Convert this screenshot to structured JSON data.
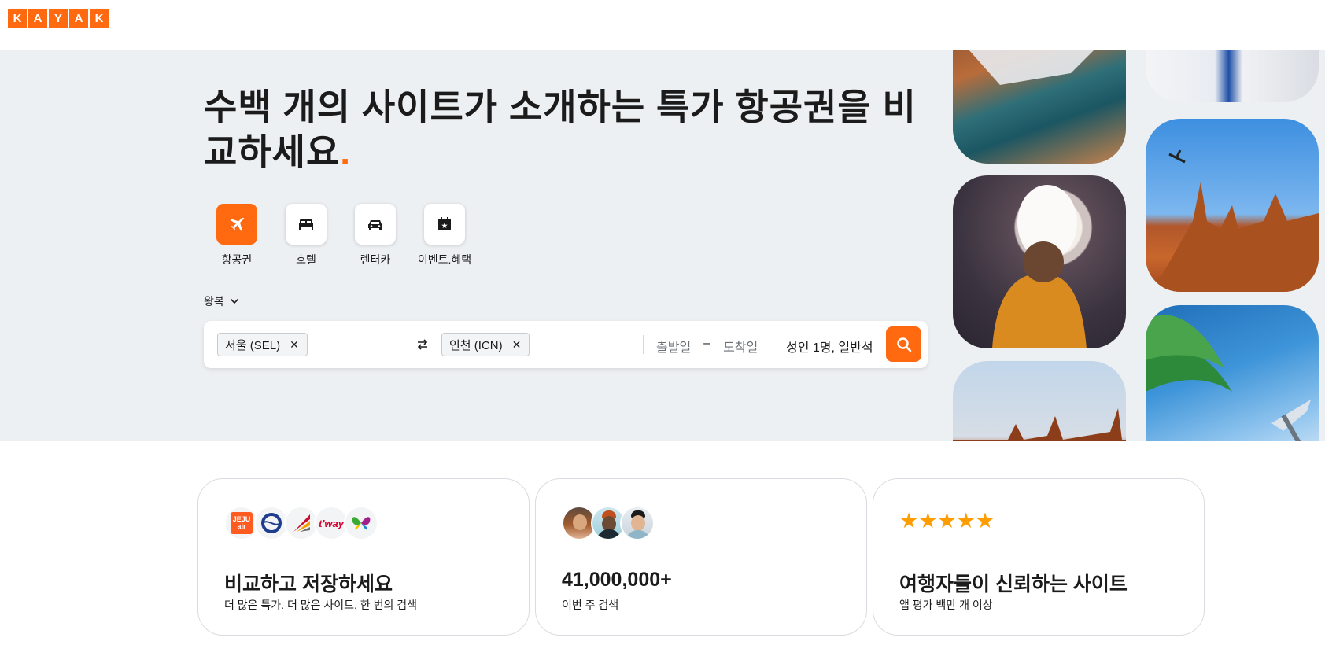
{
  "brand": {
    "letters": [
      "K",
      "A",
      "Y",
      "A",
      "K"
    ],
    "color": "#ff690f"
  },
  "hero": {
    "headline_line1": "수백 개의 사이트가 소개하는 특가 항공권을 비",
    "headline_line2": "교하세요",
    "headline_dot": ".",
    "verticals": [
      {
        "label": "항공권",
        "icon": "plane-icon",
        "active": true
      },
      {
        "label": "호텔",
        "icon": "bed-icon",
        "active": false
      },
      {
        "label": "렌터카",
        "icon": "car-icon",
        "active": false
      },
      {
        "label": "이벤트.혜택",
        "icon": "calendar-star-icon",
        "active": false
      }
    ],
    "trip_type": "왕복"
  },
  "search": {
    "origin": "서울 (SEL)",
    "destination": "인천 (ICN)",
    "depart_placeholder": "출발일",
    "date_separator": "–",
    "return_placeholder": "도착일",
    "travelers": "성인 1명, 일반석"
  },
  "cards": [
    {
      "title": "비교하고 저장하세요",
      "subtitle": "더 많은 특가. 더 많은 사이트. 한 번의 검색",
      "logos": [
        "JEJU air",
        "korean-air-logo",
        "asiana-logo",
        "t'way",
        "butterfly-logo"
      ]
    },
    {
      "title": "41,000,000+",
      "subtitle": "이번 주 검색",
      "avatars": [
        "avatar-1",
        "avatar-2",
        "avatar-3"
      ]
    },
    {
      "title": "여행자들이 신뢰하는 사이트",
      "subtitle": "앱 평가 백만 개 이상",
      "rating": 5,
      "stars": "★★★★★"
    }
  ]
}
